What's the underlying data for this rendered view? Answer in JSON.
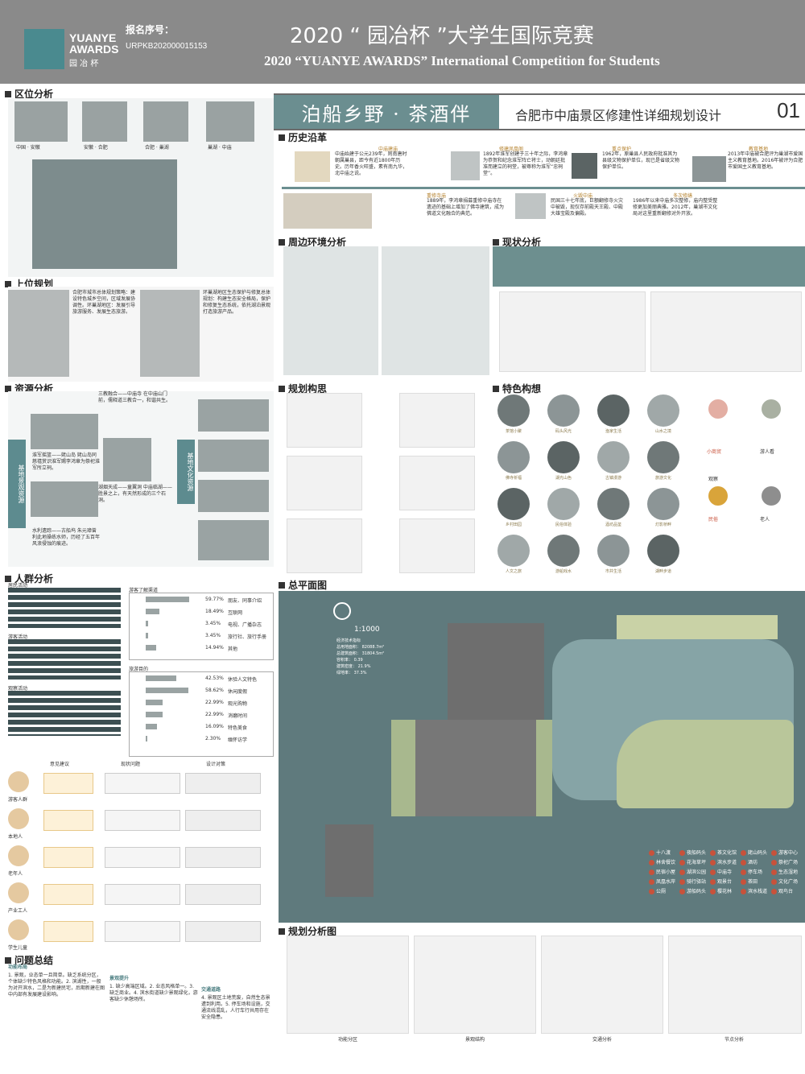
{
  "header": {
    "logo_line1": "YUANYE",
    "logo_line2": "AWARDS",
    "logo_cn": "园 冶 杯",
    "reg_label": "报名序号：",
    "reg_no": "URPKB202000015153",
    "title_cn": "2020 “ 园冶杯 ”大学生国际竞赛",
    "title_en": "2020 “YUANYE AWARDS” International Competition for  Students"
  },
  "banner": {
    "main": "泊船乡野 · 茶酒伴",
    "sub": "合肥市中庙景区修建性详细规划设计",
    "num": "01"
  },
  "sections": {
    "location": "区位分析",
    "upper_plan": "上位规划",
    "resources": "资源分析",
    "crowd": "人群分析",
    "problems": "问题总结",
    "history": "历史沿革",
    "surroundings": "周边环境分析",
    "current": "现状分析",
    "planning_idea": "规划构思",
    "feature": "特色构想",
    "master_plan": "总平面图",
    "plan_analysis": "规划分析图"
  },
  "location": {
    "maps": [
      "中国 · 安徽",
      "安徽 · 合肥",
      "合肥 · 巢湖",
      "巢湖 · 中庙"
    ]
  },
  "history": {
    "items": [
      {
        "tag": "中庙建庙",
        "text": "中庙始建于公元239年，则南唐时朝属巢县，距今有近1800年历史。历年香火旺盛，素有南九华，北中庙之说。"
      },
      {
        "tag": "重修寺庙",
        "text": "1889年，李鸿章捐募重修中庙寺在遗迹的基础上增加了佛寺建筑，成为佛道文化融合的典范。"
      },
      {
        "tag": "修建凤凰阁",
        "text": "1892年淮军创建于三十年之际，李鸿章为恭贺和纪念淮军阵亡将士，动朝廷批准而建立的祠堂，被尊称为淮军“忠祠堂”。"
      },
      {
        "tag": "火毁中庙",
        "text": "民国三十七年底，巨额翻修寺火灾中被毁，现仅存前殿天王殿、中殿大雄宝殿及偏殿。"
      },
      {
        "tag": "重点保护",
        "text": "1962年，原巢县人民政府批准其为县级文物保护单位，现已是省级文物保护单位。"
      },
      {
        "tag": "多次修缮",
        "text": "1986年以来中庙多次整修，庙内整受整修更加美丽典雅。2012年，巢湖市文化局对这里重新翻修对外开放。"
      },
      {
        "tag": "教育基地",
        "text": "2013年中庙被合肥评为巢湖市爱国主义教育基地。2016年被评为合肥市爱国主义教育基地。"
      }
    ]
  },
  "upper_plan": {
    "text1": "合肥市城市总体规划策略：建设特色城乡空间，区域发展协调性。环巢湖地区：发展引导旅游服务、发展生态旅游。",
    "text2": "环巢湖地区生态保护与修复总体规划：构建生态安全格局，保护和修复生态系统，依托湖泊景观打造旅游产品。"
  },
  "resources": {
    "side_left": "基地景观资源",
    "side_right": "基地文化资源",
    "items": [
      "三教融合——中庙寺 在中庙山门前，儒释道三教合一，和谐共生。",
      "淮军摇篮——姥山岛 姥山岛同慈禧赏识淮军赐李鸿章为祭祀淮军所立祠。",
      "湖烟天成——童翼洞 中庙临湖——胜景之上，有天然形成的三个石洞。",
      "水利遗踪——古船坞 朱元璋曾利此地操练水师，历经了五百年风浪侵蚀的痕迹。"
    ]
  },
  "crowd": {
    "resident_title": "居民活动",
    "tourist_title": "游客活动",
    "visit_title": "观察活动",
    "channel_title": "游客了解渠道",
    "channels": [
      {
        "label": "朋友、同事介绍",
        "pct": "59.77%",
        "value": 59.77
      },
      {
        "label": "互联网",
        "pct": "18.49%",
        "value": 18.49
      },
      {
        "label": "电视、广播杂志",
        "pct": "3.45%",
        "value": 3.45
      },
      {
        "label": "旅行社、旅行手册",
        "pct": "3.45%",
        "value": 3.45
      },
      {
        "label": "其他",
        "pct": "14.94%",
        "value": 14.94
      }
    ],
    "purpose_title": "旅游目的",
    "purposes": [
      {
        "label": "休验人文特色",
        "pct": "42.53%",
        "value": 42.53
      },
      {
        "label": "休闲度假",
        "pct": "58.62%",
        "value": 58.62
      },
      {
        "label": "观光购物",
        "pct": "22.99%",
        "value": 22.99
      },
      {
        "label": "消磨时间",
        "pct": "22.99%",
        "value": 22.99
      },
      {
        "label": "特色美食",
        "pct": "16.09%",
        "value": 16.09
      },
      {
        "label": "缅怀访学",
        "pct": "2.30%",
        "value": 2.3
      }
    ],
    "col_heads": [
      "意见建议",
      "现状问题",
      "设计对策"
    ],
    "personas": [
      "游客人群",
      "本地人",
      "老年人",
      "产业工人",
      "学生儿童"
    ]
  },
  "problems": {
    "col1_title": "功能布局",
    "col1": "1. 景观，业态单一且简单。缺乏系统分区，个体缺少特色风格和功能。2. 滨湖性，一般为对开滨水，二是为新建民宅，后期新建在图中内部有发展建设影响。",
    "col2_title": "景观提升",
    "col2": "1. 缺少高端区域。2. 业态风格单一。3. 缺乏商业。4. 滨水街道缺少景观绿化，游客缺少休憩场所。",
    "col3_title": "交通道路",
    "col3": "4. 景观区土地荒废，自然生态景遭到利用。5. 停车场和设施，交通流线混乱，人行车行共用存在安全隐患。"
  },
  "feature": {
    "labels": [
      "小商贸",
      "游人看",
      "观察",
      "民俗",
      "老人"
    ],
    "circle_labels": [
      "茶馆小聚",
      "码头风光",
      "渔家生活",
      "山水之境",
      "佛寺祈福",
      "湖光山色",
      "古镇漫游",
      "旅游文化",
      "乡村田园",
      "民俗体验",
      "酒坊品鉴",
      "灯影桥畔",
      "人文之旅",
      "游船戏水",
      "市井生活",
      "湖畔步道"
    ]
  },
  "master_plan": {
    "scale": "1:1000",
    "econ_title": "经济技术指标",
    "econ": [
      "总用地面积： 82088.7m²",
      "总建筑面积： 31804.5m²",
      "容积率： 0.39",
      "建筑密度： 21.9%",
      "绿地率： 37.3%"
    ],
    "legend": [
      "十八渡",
      "林舍餐饮",
      "民宿小屋",
      "凤凰水岸",
      "公厕",
      "夜船码头",
      "花海草坪",
      "湖滨公园",
      "骑行驿站",
      "游船码头",
      "茶文化馆",
      "滨水步道",
      "中庙寺",
      "观景台",
      "樱花林",
      "姥山码头",
      "酒坊",
      "停车场",
      "茶田",
      "滨水栈道",
      "游客中心",
      "祭祀广场",
      "生态湿地",
      "文化广场",
      "观鸟台"
    ]
  },
  "plan_analysis": {
    "legends": [
      "功能分区",
      "景观结构",
      "交通分析",
      "节点分析"
    ]
  }
}
